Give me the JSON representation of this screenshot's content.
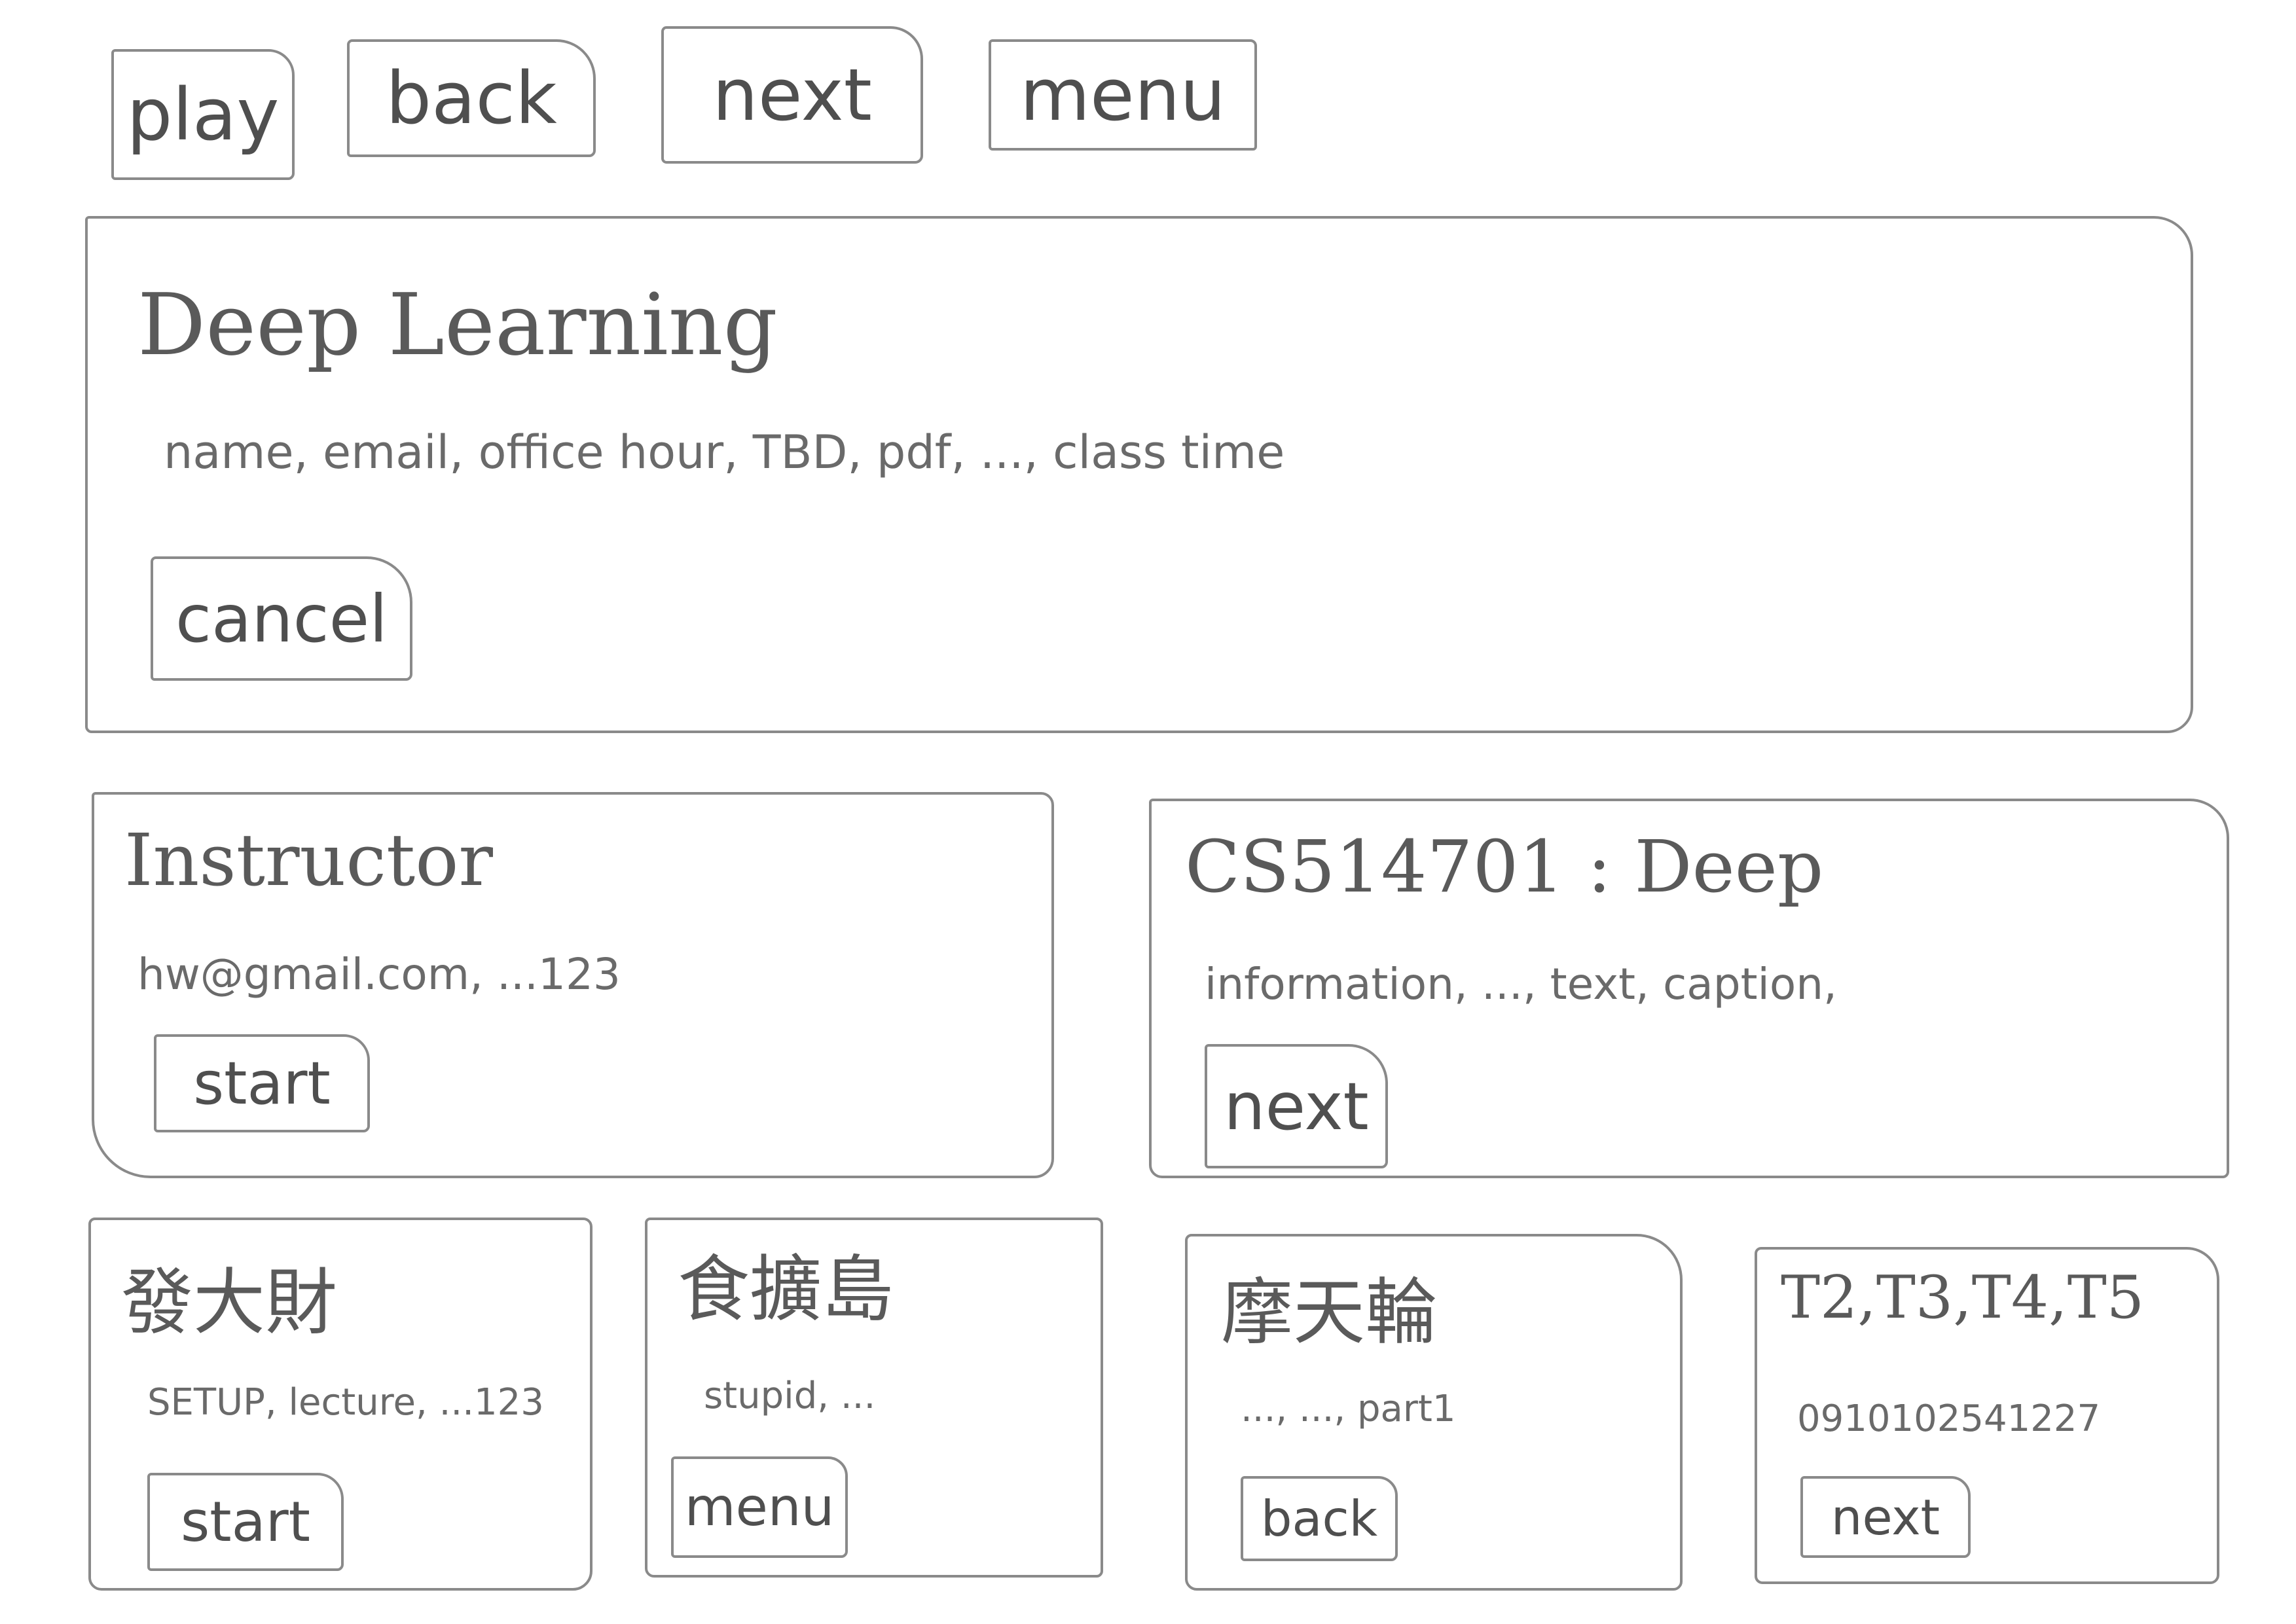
{
  "toolbar": {
    "play": "play",
    "back": "back",
    "next": "next",
    "menu": "menu"
  },
  "hero": {
    "title": "Deep Learning",
    "subtitle": "name, email, office hour, TBD, pdf, ..., class time",
    "cancel": "cancel"
  },
  "instructor_card": {
    "title": "Instructor",
    "detail": "hw@gmail.com, ...123",
    "button": "start"
  },
  "course_card": {
    "title": "CS514701 : Deep",
    "detail": "information, ..., text, caption,",
    "button": "next"
  },
  "small_cards": [
    {
      "title": "發大財",
      "detail": "SETUP, lecture, ...123",
      "button": "start"
    },
    {
      "title": "食擴島",
      "detail": "stupid, ...",
      "button": "menu"
    },
    {
      "title": "摩天輪",
      "detail": "..., ..., part1",
      "button": "back"
    },
    {
      "title": "T2,T3,T4,T5",
      "detail": "0910102541227",
      "button": "next"
    }
  ]
}
